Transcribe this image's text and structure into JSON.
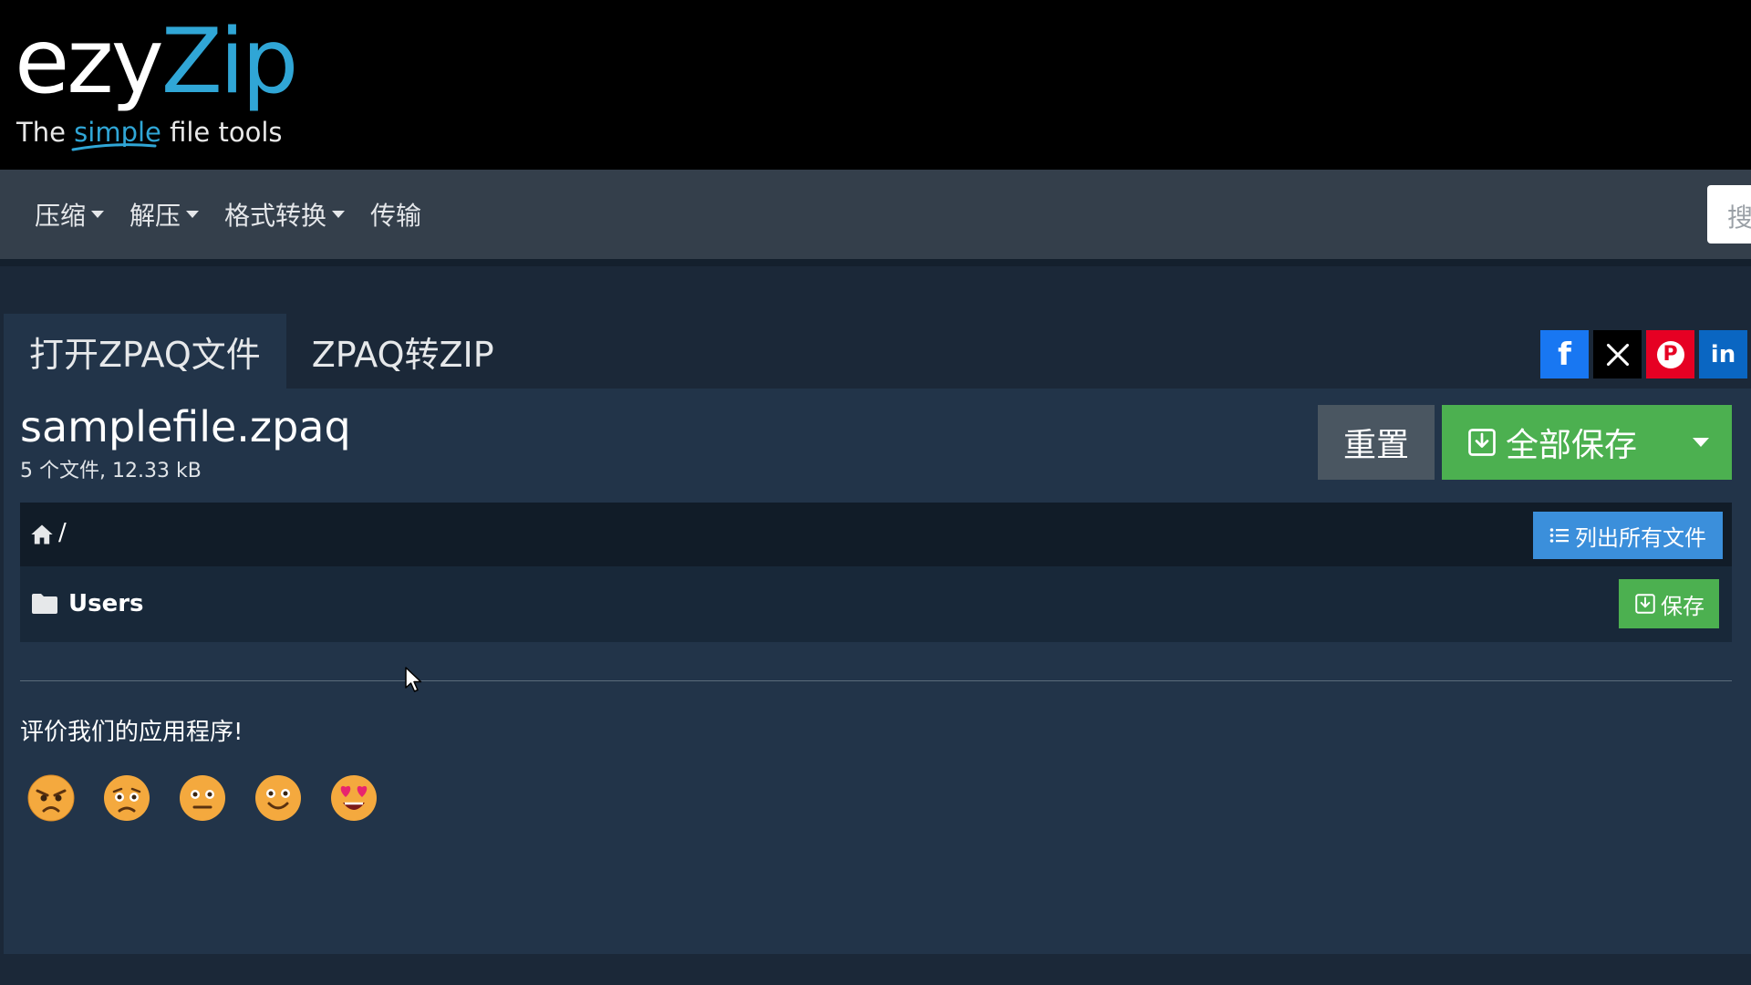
{
  "logo": {
    "word_part1": "ezy",
    "word_part2": "Zip",
    "tagline_pre": "The ",
    "tagline_accent": "simple",
    "tagline_post": " file tools",
    "accent_color": "#30a6d6"
  },
  "nav": {
    "items": [
      {
        "label": "压缩",
        "has_dropdown": true
      },
      {
        "label": "解压",
        "has_dropdown": true
      },
      {
        "label": "格式转换",
        "has_dropdown": true
      },
      {
        "label": "传输",
        "has_dropdown": false
      }
    ],
    "search_placeholder": "搜"
  },
  "tabs": [
    {
      "label": "打开ZPAQ文件",
      "active": true
    },
    {
      "label": "ZPAQ转ZIP",
      "active": false
    }
  ],
  "social": [
    {
      "name": "facebook",
      "glyph": "f",
      "color": "#1877f2"
    },
    {
      "name": "x",
      "glyph": "𝕏",
      "color": "#000000"
    },
    {
      "name": "pinterest",
      "glyph": "P",
      "color": "#e60023"
    },
    {
      "name": "linkedin",
      "glyph": "in",
      "color": "#0a66c2"
    }
  ],
  "file": {
    "name": "samplefile.zpaq",
    "meta": "5 个文件, 12.33 kB"
  },
  "actions": {
    "reset_label": "重置",
    "save_all_label": "全部保存",
    "save_all_color": "#4cb050"
  },
  "browser": {
    "path": "/",
    "list_all_label": "列出所有文件",
    "rows": [
      {
        "name": "Users",
        "type": "folder",
        "save_label": "保存"
      }
    ]
  },
  "rating": {
    "label": "评价我们的应用程序!",
    "options": [
      "angry",
      "sad",
      "neutral",
      "happy",
      "love"
    ]
  }
}
